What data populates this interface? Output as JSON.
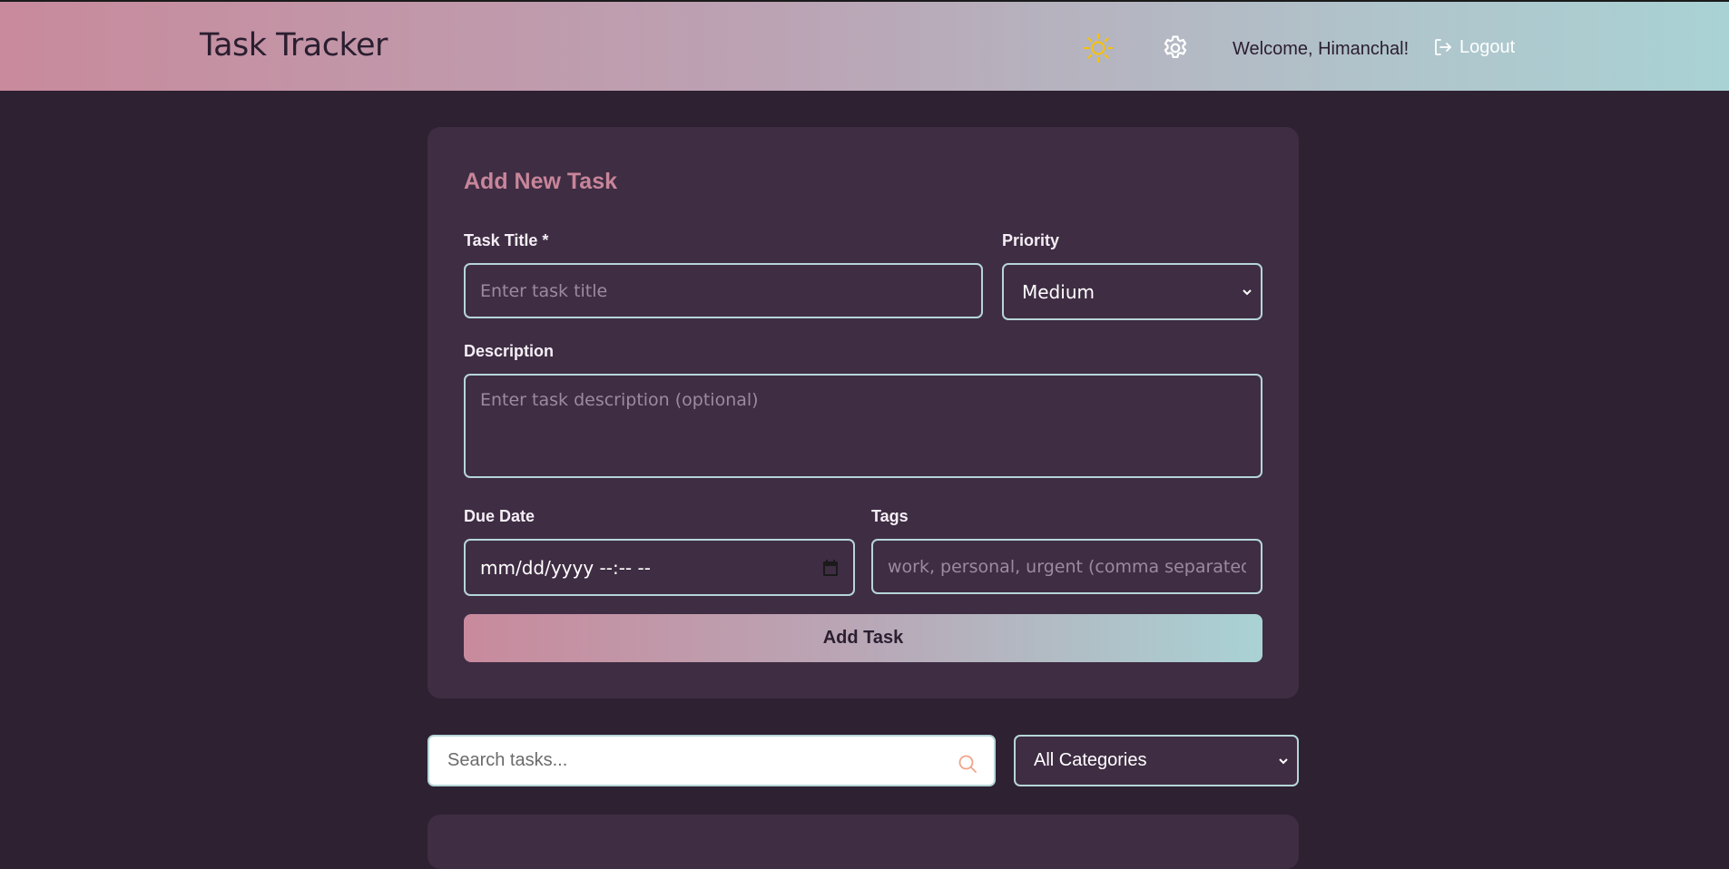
{
  "header": {
    "title": "Task Tracker",
    "welcome": "Welcome, Himanchal!",
    "logout_label": "Logout",
    "theme_icon": "sun-icon",
    "settings_icon": "gear-icon",
    "gradient_start": "#c88a9c",
    "gradient_end": "#a9d2d4"
  },
  "form": {
    "title": "Add New Task",
    "task_title_label": "Task Title *",
    "task_title_placeholder": "Enter task title",
    "task_title_value": "",
    "priority_label": "Priority",
    "priority_value": "Medium",
    "description_label": "Description",
    "description_placeholder": "Enter task description (optional)",
    "description_value": "",
    "due_date_label": "Due Date",
    "due_date_value": "mm/dd/yyyy --:-- --",
    "tags_label": "Tags",
    "tags_placeholder": "work, personal, urgent (comma separated)",
    "tags_value": "",
    "submit_label": "Add Task"
  },
  "filters": {
    "search_placeholder": "Search tasks...",
    "category_value": "All Categories"
  },
  "colors": {
    "background": "#2e2132",
    "card": "#3f2d43",
    "accent": "#c8859a",
    "border": "#b6d6d9",
    "sun": "#f4c20d",
    "search_icon": "#f0a58a"
  }
}
